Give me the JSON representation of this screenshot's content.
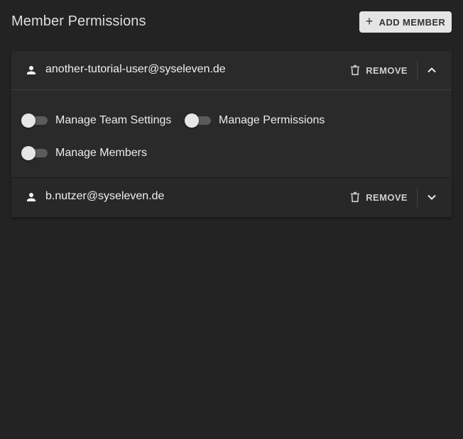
{
  "header": {
    "title": "Member Permissions",
    "add_member_label": "ADD MEMBER",
    "add_member_icon": "plus-icon"
  },
  "members": [
    {
      "email": "another-tutorial-user@syseleven.de",
      "remove_label": "REMOVE",
      "expanded": true,
      "permissions": [
        {
          "label": "Manage Team Settings",
          "enabled": false
        },
        {
          "label": "Manage Permissions",
          "enabled": false
        },
        {
          "label": "Manage Members",
          "enabled": false
        }
      ]
    },
    {
      "email": "b.nutzer@syseleven.de",
      "remove_label": "REMOVE",
      "expanded": false
    }
  ],
  "colors": {
    "background": "#232323",
    "panel": "#2a2a2a",
    "button": "#e5e5e5",
    "toggle_track": "#5b5b5b",
    "toggle_knob": "#e6e6e6"
  }
}
